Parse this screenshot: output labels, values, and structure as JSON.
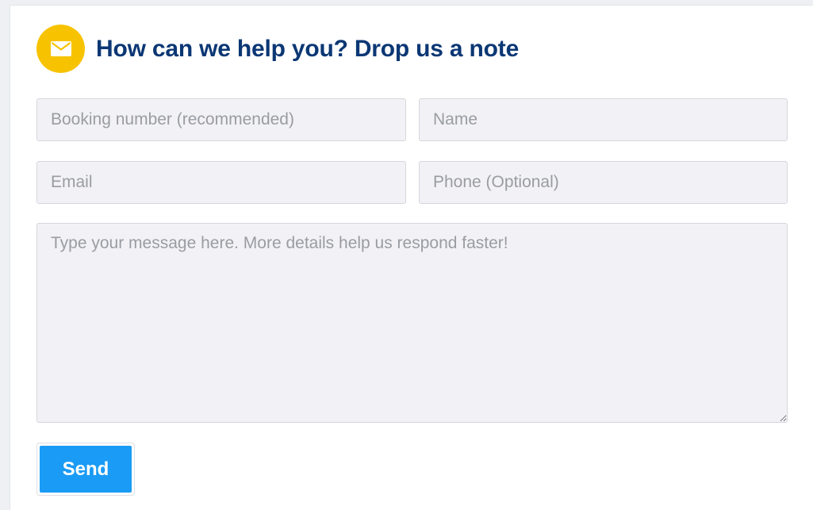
{
  "header": {
    "title": "How can we help you? Drop us a note",
    "icon": "mail-icon",
    "icon_color": "#f7c300"
  },
  "form": {
    "booking_placeholder": "Booking number (recommended)",
    "name_placeholder": "Name",
    "email_placeholder": "Email",
    "phone_placeholder": "Phone (Optional)",
    "message_placeholder": "Type your message here. More details help us respond faster!",
    "send_label": "Send"
  },
  "colors": {
    "title": "#0b3774",
    "send_button": "#1a9bf5",
    "field_background": "#f2f2f6"
  }
}
